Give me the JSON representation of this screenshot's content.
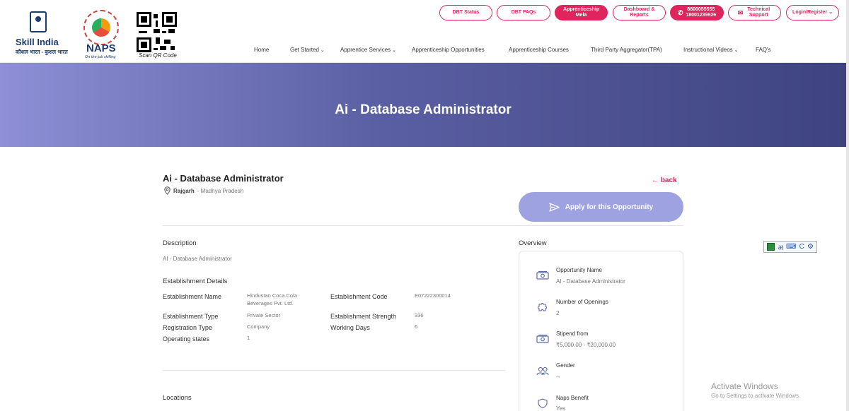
{
  "header": {
    "skill_india_title": "Skill India",
    "skill_india_sub": "कौशल भारत - कुशल भारत",
    "naps_title": "NAPS",
    "naps_tagline": "On the job skilling",
    "qr_label": "Scan QR Code",
    "top_buttons": {
      "dbt_status": "DBT Status",
      "dbt_faqs": "DBT FAQs",
      "apprenticeship_mela": "Apprenticeship Mela",
      "dashboard_reports": "Dashboard & Reports",
      "phone1": "8800055555",
      "phone2": "18001239626",
      "technical_support": "Technical Support",
      "login_register": "Login/Register"
    },
    "nav": {
      "home": "Home",
      "get_started": "Get Started",
      "apprentice_services": "Apprentice Services",
      "apprenticeship_opportunities": "Apprenticeship Opportunities",
      "apprenticeship_courses": "Apprenticeship Courses",
      "third_party": "Third Party Aggregator(TPA)",
      "instructional_videos": "Instructional Videos",
      "faqs": "FAQ's"
    }
  },
  "banner": {
    "title": "Ai - Database Administrator"
  },
  "job": {
    "title": "Ai - Database Administrator",
    "city": "Rajgarh",
    "state": "- Madhya Pradesh",
    "back": "← back",
    "apply": "Apply for this Opportunity"
  },
  "description": {
    "heading": "Description",
    "text": "AI - Database Administrator"
  },
  "establishment": {
    "heading": "Establishment Details",
    "name_label": "Establishment Name",
    "name_value_1": "Hindustan Coca Cola",
    "name_value_2": "Beverages Pvt. Ltd.",
    "code_label": "Establishment Code",
    "code_value": "E07222300014",
    "type_label": "Establishment Type",
    "type_value": "Private Sector",
    "strength_label": "Establishment Strength",
    "strength_value": "336",
    "reg_label": "Registration Type",
    "reg_value": "Company",
    "days_label": "Working Days",
    "days_value": "6",
    "states_label": "Operating states",
    "states_value": "1"
  },
  "locations": {
    "heading": "Locations"
  },
  "overview": {
    "heading": "Overview",
    "items": [
      {
        "label": "Opportunity Name",
        "value": "AI - Database Administrator",
        "icon": "money-icon"
      },
      {
        "label": "Number of Openings",
        "value": "2",
        "icon": "puzzle-icon"
      },
      {
        "label": "Stipend from",
        "value": "₹5,000.00 - ₹20,000.00",
        "icon": "money-icon"
      },
      {
        "label": "Gender",
        "value": "--",
        "icon": "users-icon"
      },
      {
        "label": "Naps Benefit",
        "value": "Yes",
        "icon": "shield-icon"
      }
    ]
  },
  "translit": {
    "hindi": "अ",
    "keyboard": "⌨",
    "c": "C",
    "gear": "⚙"
  },
  "watermark": {
    "line1": "Activate Windows",
    "line2": "Go to Settings to activate Windows."
  }
}
